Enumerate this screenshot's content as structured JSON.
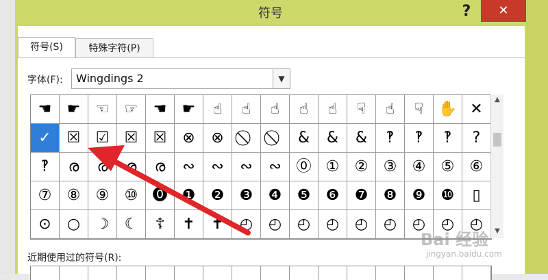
{
  "dialog": {
    "title": "符号",
    "help_label": "?",
    "close_label": "✕"
  },
  "tabs": [
    {
      "label": "符号(S)"
    },
    {
      "label": "特殊字符(P)"
    }
  ],
  "font": {
    "label": "字体(F):",
    "value": "Wingdings 2"
  },
  "symbols": [
    [
      "☚",
      "☛",
      "☜",
      "☞",
      "☚",
      "☛",
      "☝",
      "☝",
      "☝",
      "☝",
      "☝",
      "☟",
      "☝",
      "☟",
      "✋",
      "✕"
    ],
    [
      "✓",
      "☒",
      "☑",
      "☒",
      "☒",
      "⊗",
      "⊗",
      "⃠",
      "⃠",
      "&",
      "&",
      "&",
      "‽",
      "‽",
      "‽",
      "?"
    ],
    [
      "‽",
      "ര",
      "ര",
      "ര",
      "ര",
      "∾",
      "∾",
      "∾",
      "∾",
      "⓪",
      "①",
      "②",
      "③",
      "④",
      "⑤",
      "⑥"
    ],
    [
      "⑦",
      "⑧",
      "⑨",
      "⑩",
      "⓿",
      "❶",
      "❷",
      "❸",
      "❹",
      "❺",
      "❻",
      "❼",
      "❽",
      "❾",
      "❿",
      "▯"
    ],
    [
      "⊙",
      "○",
      "☽",
      "☾",
      "☦",
      "✝",
      "✝",
      "◴",
      "◴",
      "◴",
      "◴",
      "◴",
      "◴",
      "◴",
      "◴",
      "◴"
    ]
  ],
  "selected_cell": {
    "row": 1,
    "col": 0
  },
  "recent": {
    "label": "近期使用过的符号(R):"
  },
  "watermark": {
    "logo": "Bai 经验",
    "url": "jingyan.baidu.com"
  },
  "colors": {
    "dialog_frame": "#cdd86a",
    "close_button": "#c73a2a",
    "selection": "#2f7fd9",
    "annotation_arrow": "#e0262a"
  }
}
